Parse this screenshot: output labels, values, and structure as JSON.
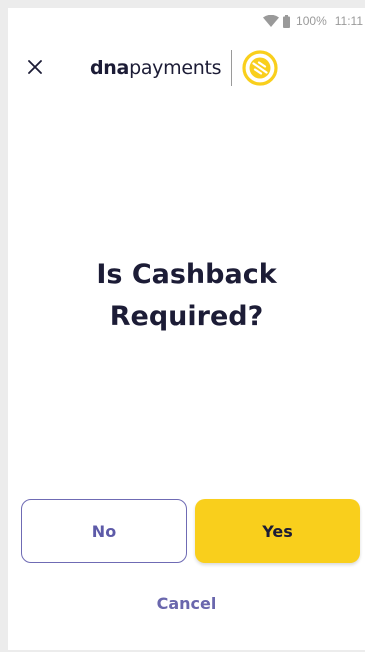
{
  "status_bar": {
    "battery_percent": "100%",
    "time": "11:11",
    "icons": [
      "wifi-icon",
      "battery-icon"
    ]
  },
  "header": {
    "close_icon": "close-icon",
    "logo": {
      "bold_part": "dna",
      "light_part": "payments",
      "mark_icon": "dna-logo-mark"
    }
  },
  "prompt": {
    "line1": "Is Cashback",
    "line2": "Required?"
  },
  "actions": {
    "no_label": "No",
    "yes_label": "Yes",
    "cancel_label": "Cancel"
  },
  "colors": {
    "brand_yellow": "#f9cf1c",
    "brand_navy": "#1c1c36",
    "brand_purple": "#6a67ad"
  }
}
